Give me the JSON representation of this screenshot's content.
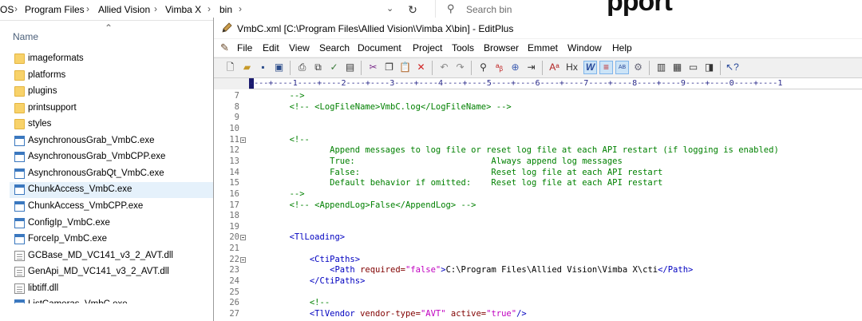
{
  "explorer": {
    "breadcrumbs": [
      "OS",
      "Program Files",
      "Allied Vision",
      "Vimba X",
      "bin"
    ],
    "search_placeholder": "Search bin",
    "column_name": "Name",
    "background_heading": "pport",
    "files": [
      {
        "name": "imageformats",
        "type": "folder"
      },
      {
        "name": "platforms",
        "type": "folder"
      },
      {
        "name": "plugins",
        "type": "folder"
      },
      {
        "name": "printsupport",
        "type": "folder"
      },
      {
        "name": "styles",
        "type": "folder"
      },
      {
        "name": "AsynchronousGrab_VmbC.exe",
        "type": "exe"
      },
      {
        "name": "AsynchronousGrab_VmbCPP.exe",
        "type": "exe"
      },
      {
        "name": "AsynchronousGrabQt_VmbC.exe",
        "type": "exe"
      },
      {
        "name": "ChunkAccess_VmbC.exe",
        "type": "exe",
        "selected": true
      },
      {
        "name": "ChunkAccess_VmbCPP.exe",
        "type": "exe"
      },
      {
        "name": "ConfigIp_VmbC.exe",
        "type": "exe"
      },
      {
        "name": "ForceIp_VmbC.exe",
        "type": "exe"
      },
      {
        "name": "GCBase_MD_VC141_v3_2_AVT.dll",
        "type": "dll"
      },
      {
        "name": "GenApi_MD_VC141_v3_2_AVT.dll",
        "type": "dll"
      },
      {
        "name": "libtiff.dll",
        "type": "dll"
      },
      {
        "name": "ListCameras_VmbC.exe",
        "type": "exe"
      }
    ]
  },
  "editor": {
    "title": "VmbC.xml [C:\\Program Files\\Allied Vision\\Vimba X\\bin] - EditPlus",
    "menu": [
      "File",
      "Edit",
      "View",
      "Search",
      "Document",
      "Project",
      "Tools",
      "Browser",
      "Emmet",
      "Window",
      "Help"
    ],
    "ruler": "----+----1----+----2----+----3----+----4----+----5----+----6----+----7----+----8----+----9----+----0----+----1",
    "line_numbers": [
      "7",
      "8",
      "9",
      "10",
      "11",
      "12",
      "13",
      "14",
      "15",
      "16",
      "17",
      "18",
      "19",
      "20",
      "21",
      "22",
      "23",
      "24",
      "25",
      "26",
      "27"
    ],
    "fold_lines": [
      "11",
      "20",
      "22"
    ],
    "code": [
      [
        {
          "t": "        -->",
          "c": "com"
        }
      ],
      [
        {
          "t": "        <!-- <LogFileName>VmbC.log</LogFileName> -->",
          "c": "com"
        }
      ],
      [],
      [],
      [
        {
          "t": "        <!--",
          "c": "com"
        }
      ],
      [
        {
          "t": "                Append messages to log file or reset log file at each API restart (if logging is enabled)",
          "c": "com"
        }
      ],
      [
        {
          "t": "                True:                           Always append log messages",
          "c": "com"
        }
      ],
      [
        {
          "t": "                False:                          Reset log file at each API restart",
          "c": "com"
        }
      ],
      [
        {
          "t": "                Default behavior if omitted:    Reset log file at each API restart",
          "c": "com"
        }
      ],
      [
        {
          "t": "        -->",
          "c": "com"
        }
      ],
      [
        {
          "t": "        <!-- <AppendLog>False</AppendLog> -->",
          "c": "com"
        }
      ],
      [],
      [],
      [
        {
          "t": "        <TlLoading>",
          "c": "tag"
        }
      ],
      [],
      [
        {
          "t": "            <CtiPaths>",
          "c": "tag"
        }
      ],
      [
        {
          "t": "                <Path ",
          "c": "tag"
        },
        {
          "t": "required=",
          "c": "attr"
        },
        {
          "t": "\"false\"",
          "c": "str"
        },
        {
          "t": ">",
          "c": "tag"
        },
        {
          "t": "C:\\Program Files\\Allied Vision\\Vimba X\\cti",
          "c": "txt"
        },
        {
          "t": "</Path>",
          "c": "tag"
        }
      ],
      [
        {
          "t": "            </CtiPaths>",
          "c": "tag"
        }
      ],
      [],
      [
        {
          "t": "            <!--",
          "c": "com"
        }
      ],
      [
        {
          "t": "            <TlVendor ",
          "c": "tag"
        },
        {
          "t": "vendor-type=",
          "c": "attr"
        },
        {
          "t": "\"AVT\"",
          "c": "str"
        },
        {
          "t": " ",
          "c": "txt"
        },
        {
          "t": "active=",
          "c": "attr"
        },
        {
          "t": "\"true\"",
          "c": "str"
        },
        {
          "t": "/>",
          "c": "tag"
        }
      ]
    ]
  }
}
